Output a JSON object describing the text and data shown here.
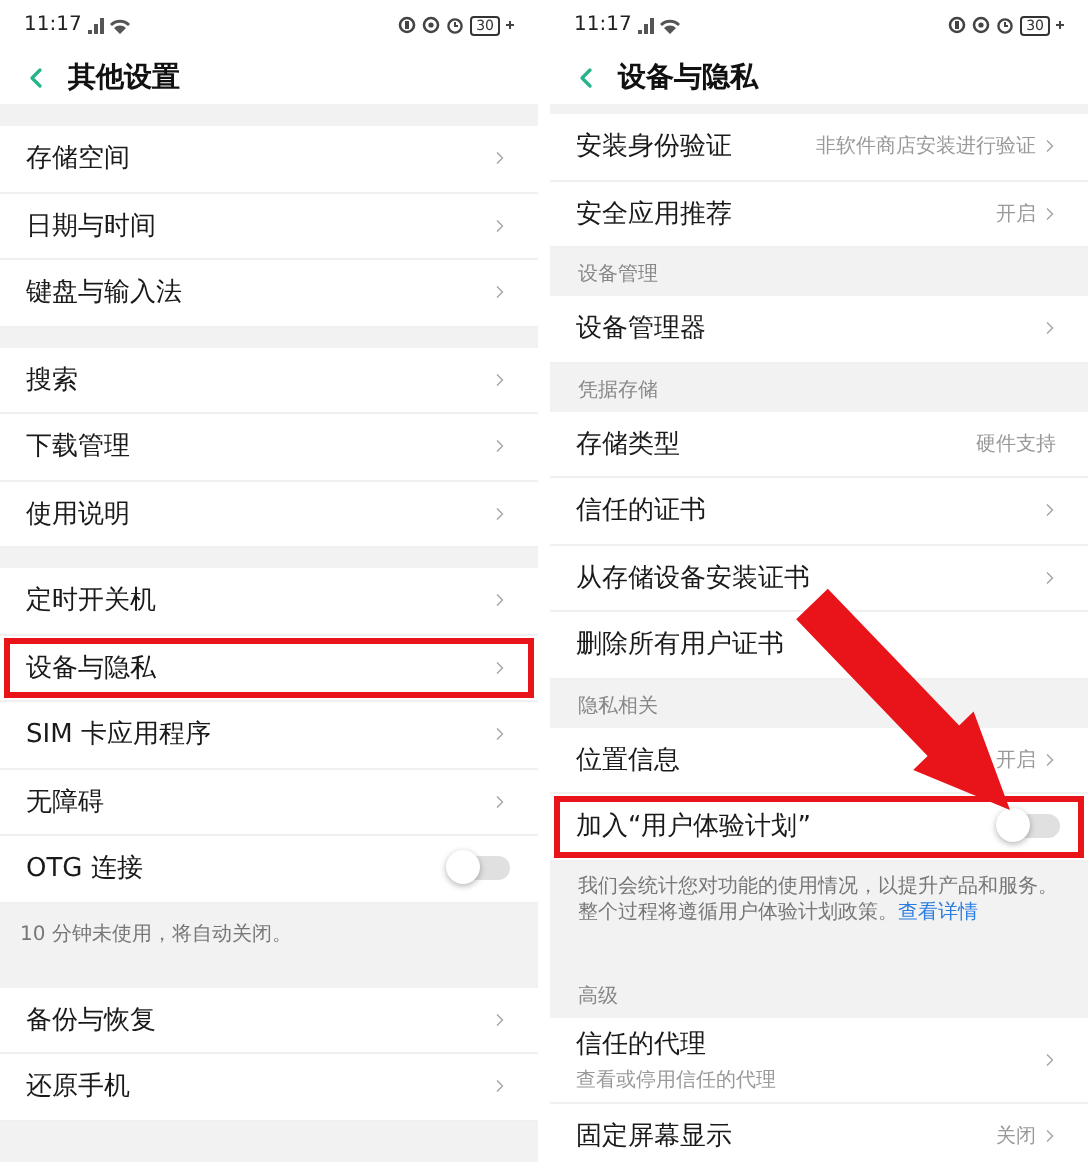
{
  "screens": [
    {
      "status_bar": {
        "time": "11:17",
        "battery": "30"
      },
      "title": "其他设置",
      "groups": [
        {
          "rows": [
            {
              "kind": "link",
              "label": "存储空间",
              "highlighted": false
            },
            {
              "kind": "link",
              "label": "日期与时间",
              "highlighted": false
            },
            {
              "kind": "link",
              "label": "键盘与输入法",
              "highlighted": false
            }
          ]
        },
        {
          "rows": [
            {
              "kind": "link",
              "label": "搜索",
              "highlighted": false
            },
            {
              "kind": "link",
              "label": "下载管理",
              "highlighted": false
            },
            {
              "kind": "link",
              "label": "使用说明",
              "highlighted": false
            }
          ]
        },
        {
          "rows": [
            {
              "kind": "link",
              "label": "定时开关机",
              "highlighted": false
            },
            {
              "kind": "link",
              "label": "设备与隐私",
              "highlighted": true
            },
            {
              "kind": "link",
              "label": "SIM 卡应用程序",
              "highlighted": false
            },
            {
              "kind": "link",
              "label": "无障碍",
              "highlighted": false
            },
            {
              "kind": "toggle",
              "label": "OTG 连接",
              "on": false,
              "highlighted": false
            }
          ],
          "note": "10 分钟未使用，将自动关闭。"
        },
        {
          "rows": [
            {
              "kind": "link",
              "label": "备份与恢复",
              "highlighted": false
            },
            {
              "kind": "link",
              "label": "还原手机",
              "highlighted": false
            }
          ]
        }
      ]
    },
    {
      "status_bar": {
        "time": "11:17",
        "battery": "30"
      },
      "title": "设备与隐私",
      "groups": [
        {
          "rows": [
            {
              "kind": "link",
              "label": "安装身份验证",
              "value": "非软件商店安装进行验证",
              "highlighted": false
            },
            {
              "kind": "link",
              "label": "安全应用推荐",
              "value": "开启",
              "highlighted": false
            }
          ]
        },
        {
          "header": "设备管理",
          "rows": [
            {
              "kind": "link",
              "label": "设备管理器",
              "highlighted": false
            }
          ]
        },
        {
          "header": "凭据存储",
          "rows": [
            {
              "kind": "info",
              "label": "存储类型",
              "value": "硬件支持",
              "highlighted": false
            },
            {
              "kind": "link",
              "label": "信任的证书",
              "highlighted": false
            },
            {
              "kind": "link",
              "label": "从存储设备安装证书",
              "highlighted": false
            },
            {
              "kind": "info",
              "label": "删除所有用户证书",
              "highlighted": false
            }
          ]
        },
        {
          "header": "隐私相关",
          "rows": [
            {
              "kind": "link",
              "label": "位置信息",
              "value": "开启",
              "highlighted": false
            },
            {
              "kind": "toggle",
              "label": "加入“用户体验计划”",
              "on": false,
              "highlighted": true
            }
          ],
          "note": "我们会统计您对功能的使用情况，以提升产品和服务。整个过程将遵循用户体验计划政策。",
          "note_link": "查看详情"
        },
        {
          "header": "高级",
          "rows": [
            {
              "kind": "link",
              "label": "信任的代理",
              "subtitle": "查看或停用信任的代理",
              "highlighted": false
            },
            {
              "kind": "link",
              "label": "固定屏幕显示",
              "value": "关闭",
              "highlighted": false
            }
          ]
        }
      ]
    }
  ]
}
